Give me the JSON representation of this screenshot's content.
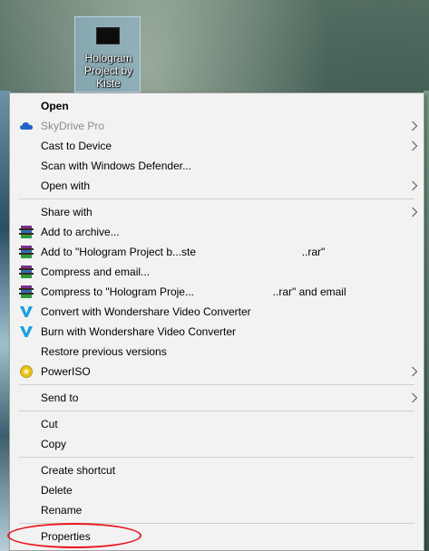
{
  "desktop": {
    "file_icon": {
      "name_lines": [
        "Hologram",
        "Project by",
        "Kiste"
      ],
      "icon": "video-file-icon"
    }
  },
  "menu": {
    "items": [
      {
        "label": "Open",
        "bold": true
      },
      {
        "label": "SkyDrive Pro",
        "disabled": true,
        "icon": "skydrive-cloud-icon",
        "submenu": true
      },
      {
        "label": "Cast to Device",
        "submenu": true
      },
      {
        "label": "Scan with Windows Defender..."
      },
      {
        "label": "Open with",
        "submenu": true
      },
      {
        "label": "Share with",
        "submenu": true
      },
      {
        "label": "Add to archive...",
        "icon": "winrar-icon"
      },
      {
        "label": "Add to \"Hologram Project b...ste                                   ..rar\"",
        "icon": "winrar-icon"
      },
      {
        "label": "Compress and email...",
        "icon": "winrar-icon"
      },
      {
        "label": "Compress to \"Hologram Proje...                          ..rar\" and email",
        "icon": "winrar-icon"
      },
      {
        "label": "Convert with Wondershare Video Converter",
        "icon": "wondershare-icon"
      },
      {
        "label": "Burn with Wondershare Video Converter",
        "icon": "wondershare-icon"
      },
      {
        "label": "Restore previous versions"
      },
      {
        "label": "PowerISO",
        "icon": "poweriso-disc-icon",
        "submenu": true
      },
      {
        "label": "Send to",
        "submenu": true
      },
      {
        "label": "Cut"
      },
      {
        "label": "Copy"
      },
      {
        "label": "Create shortcut"
      },
      {
        "label": "Delete"
      },
      {
        "label": "Rename"
      },
      {
        "label": "Properties"
      }
    ]
  },
  "colors": {
    "menu_bg": "#f2f2f2",
    "annotation": "#e8171f",
    "skydrive": "#1e64c8",
    "wondershare": "#1aa0e0"
  }
}
